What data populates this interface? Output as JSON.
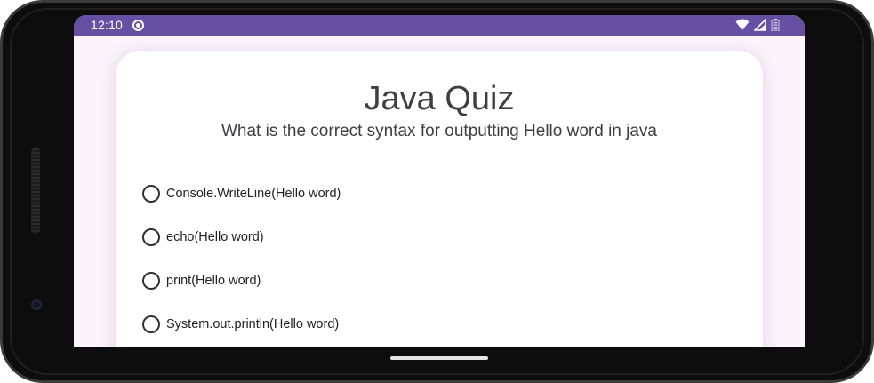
{
  "status_bar": {
    "time": "12:10",
    "icons": [
      "notification-dot-icon",
      "wifi-icon",
      "cellular-signal-icon",
      "battery-icon"
    ],
    "color": "#6750a4"
  },
  "quiz": {
    "title": "Java Quiz",
    "question": "What is the correct syntax for outputting Hello word in java",
    "options": [
      {
        "label": "Console.WriteLine(Hello word)",
        "selected": false
      },
      {
        "label": "echo(Hello word)",
        "selected": false
      },
      {
        "label": "print(Hello word)",
        "selected": false
      },
      {
        "label": "System.out.println(Hello word)",
        "selected": false
      }
    ]
  },
  "theme": {
    "screen_background": "#fbf4fb",
    "card_background": "#ffffff",
    "text_color": "#3e3e44"
  }
}
